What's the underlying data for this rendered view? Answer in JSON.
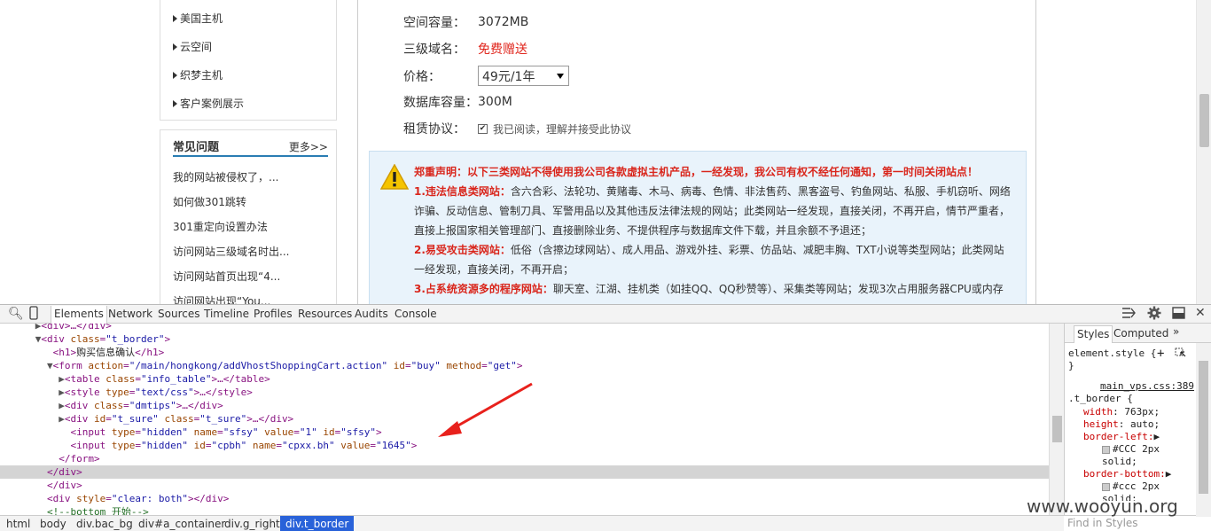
{
  "left_menu": {
    "items": [
      "美国主机",
      "云空间",
      "织梦主机",
      "客户案例展示"
    ]
  },
  "faq": {
    "title": "常见问题",
    "more": "更多>>",
    "questions": [
      "我的网站被侵权了，...",
      "如何做301跳转",
      "301重定向设置办法",
      "访问网站三级域名时出...",
      "访问网站首页出现“4...",
      "访问网站出现“You..."
    ]
  },
  "form": {
    "space_label": "空间容量：",
    "space_value": "3072MB",
    "domain_label": "三级域名：",
    "domain_value": "免费赠送",
    "price_label": "价格：",
    "price_selected": "49元/1年",
    "db_label": "数据库容量：",
    "db_value": "300M",
    "lease_label": "租赁协议：",
    "agree_text": "我已阅读，理解并接受此协议"
  },
  "warning": {
    "line1": "郑重声明：以下三类网站不得使用我公司各款虚拟主机产品，一经发现，我公司有权不经任何通知，第一时间关闭站点！",
    "p1_head": "1.违法信息类网站：",
    "p1_a": "含六合彩、法轮功、黄赌毒、木马、病毒、色情、非法售药、黑客盗号、钓鱼网站、私服、手机窃听、网络",
    "p1_b": "诈骗、反动信息、管制刀具、军警用品以及其他违反法律法规的网站；此类网站一经发现，直接关闭，不再开启，情节严重者，",
    "p1_c": "直接上报国家相关管理部门、直接删除业务、不提供程序与数据库文件下载，并且余额不予退还；",
    "p2_head": "2.易受攻击类网站：",
    "p2_a": "低俗（含擦边球网站）、成人用品、游戏外挂、彩票、仿品站、减肥丰胸、TXT小说等类型网站；此类网站",
    "p2_b": "一经发现，直接关闭，不再开启；",
    "p3_head": "3.占系统资源多的程序网站：",
    "p3_a": "聊天室、江湖、挂机类（如挂QQ、QQ秒赞等）、采集类等网站；发现3次占用服务器CPU或内存"
  },
  "devtools": {
    "tabs": [
      "Elements",
      "Network",
      "Sources",
      "Timeline",
      "Profiles",
      "Resources",
      "Audits",
      "Console"
    ],
    "code": {
      "l0": "<div>…</div>",
      "l1_tag": "div",
      "l1_attr": "class",
      "l1_val": "\"t_border\"",
      "l2_text": "购买信息确认",
      "l3_action": "\"/main/hongkong/addVhostShoppingCart.action\"",
      "l3_id": "\"buy\"",
      "l3_method": "\"get\"",
      "l4_val": "\"info_table\"",
      "l5_val": "\"text/css\"",
      "l6_val": "\"dmtips\"",
      "l7_id": "\"t_sure\"",
      "l7_class": "\"t_sure\"",
      "l8": {
        "type": "\"hidden\"",
        "name": "\"sfsy\"",
        "value": "\"1\"",
        "id": "\"sfsy\""
      },
      "l9": {
        "type": "\"hidden\"",
        "id": "\"cpbh\"",
        "name": "\"cpxx.bh\"",
        "value": "\"1645\""
      },
      "l13_style": "\"clear: both\"",
      "l14_comment": "<!--bottom 开始-->"
    },
    "breadcrumbs": [
      "html",
      "body",
      "div.bac_bg",
      "div#a_container",
      "div.g_right",
      "div.t_border"
    ],
    "styles": {
      "tabs": [
        "Styles",
        "Computed"
      ],
      "element_style": "element.style {",
      "close_brace": "}",
      "source": "main_vps.css:389",
      "selector": ".t_border {",
      "props": [
        {
          "name": "width",
          "value": "763px;"
        },
        {
          "name": "height",
          "value": "auto;"
        },
        {
          "name": "border-left",
          "value": ""
        },
        {
          "name": "border-bottom",
          "value": ""
        }
      ],
      "bl_color": "#CCC 2px",
      "bl_style": "solid;",
      "bb_color": "#ccc 2px",
      "bb_style": "solid;",
      "filter_placeholder": "Find in Styles"
    }
  },
  "watermark": "www.wooyun.org"
}
